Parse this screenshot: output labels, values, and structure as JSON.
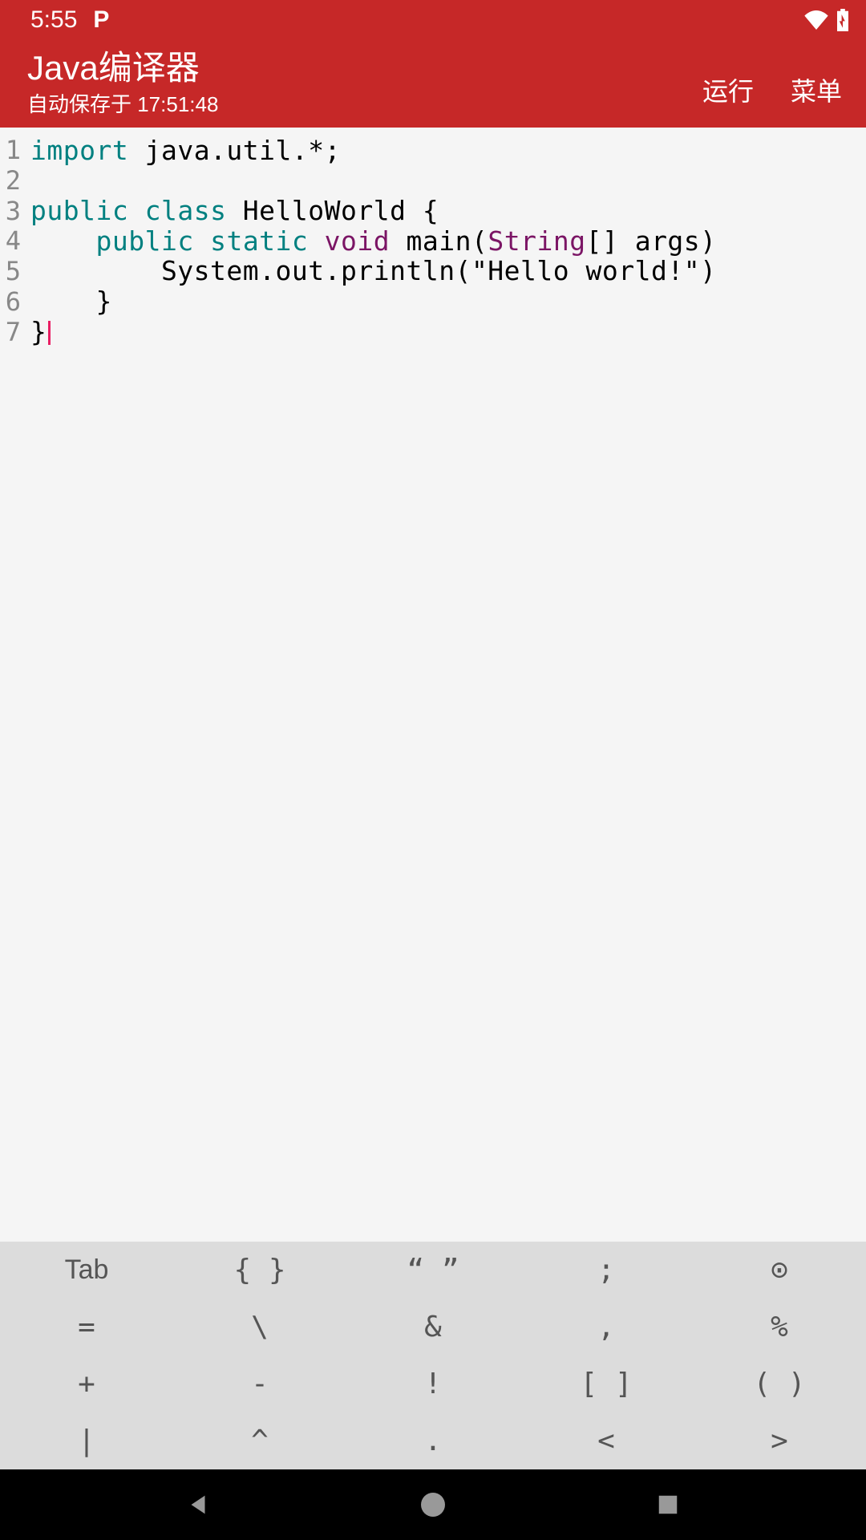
{
  "status_bar": {
    "time": "5:55",
    "app_indicator": "P"
  },
  "app_bar": {
    "title": "Java编译器",
    "subtitle": "自动保存于 17:51:48",
    "run_button": "运行",
    "menu_button": "菜单"
  },
  "editor": {
    "line_numbers": [
      "1",
      "2",
      "3",
      "4",
      "5",
      "6",
      "7"
    ],
    "code_lines": [
      {
        "tokens": [
          {
            "t": "import",
            "c": "kw"
          },
          {
            "t": " java.util.*;",
            "c": ""
          }
        ]
      },
      {
        "tokens": [
          {
            "t": "",
            "c": ""
          }
        ]
      },
      {
        "tokens": [
          {
            "t": "public",
            "c": "kw"
          },
          {
            "t": " ",
            "c": ""
          },
          {
            "t": "class",
            "c": "kw"
          },
          {
            "t": " HelloWorld {",
            "c": ""
          }
        ]
      },
      {
        "tokens": [
          {
            "t": "    ",
            "c": ""
          },
          {
            "t": "public",
            "c": "kw"
          },
          {
            "t": " ",
            "c": ""
          },
          {
            "t": "static",
            "c": "kw"
          },
          {
            "t": " ",
            "c": ""
          },
          {
            "t": "void",
            "c": "type"
          },
          {
            "t": " main(",
            "c": ""
          },
          {
            "t": "String",
            "c": "type"
          },
          {
            "t": "[] args)",
            "c": ""
          }
        ]
      },
      {
        "tokens": [
          {
            "t": "        System.out.println(",
            "c": ""
          },
          {
            "t": "\"Hello world!\"",
            "c": "str"
          },
          {
            "t": ")",
            "c": ""
          }
        ]
      },
      {
        "tokens": [
          {
            "t": "    }",
            "c": ""
          }
        ]
      },
      {
        "tokens": [
          {
            "t": "}",
            "c": ""
          }
        ],
        "cursor": true
      }
    ]
  },
  "symbol_keys": [
    "Tab",
    "{ }",
    "“ ”",
    ";",
    "⊙",
    "=",
    "\\",
    "&",
    ",",
    "%",
    "+",
    "-",
    "!",
    "[ ]",
    "( )",
    "|",
    "^",
    ".",
    "<",
    ">"
  ]
}
